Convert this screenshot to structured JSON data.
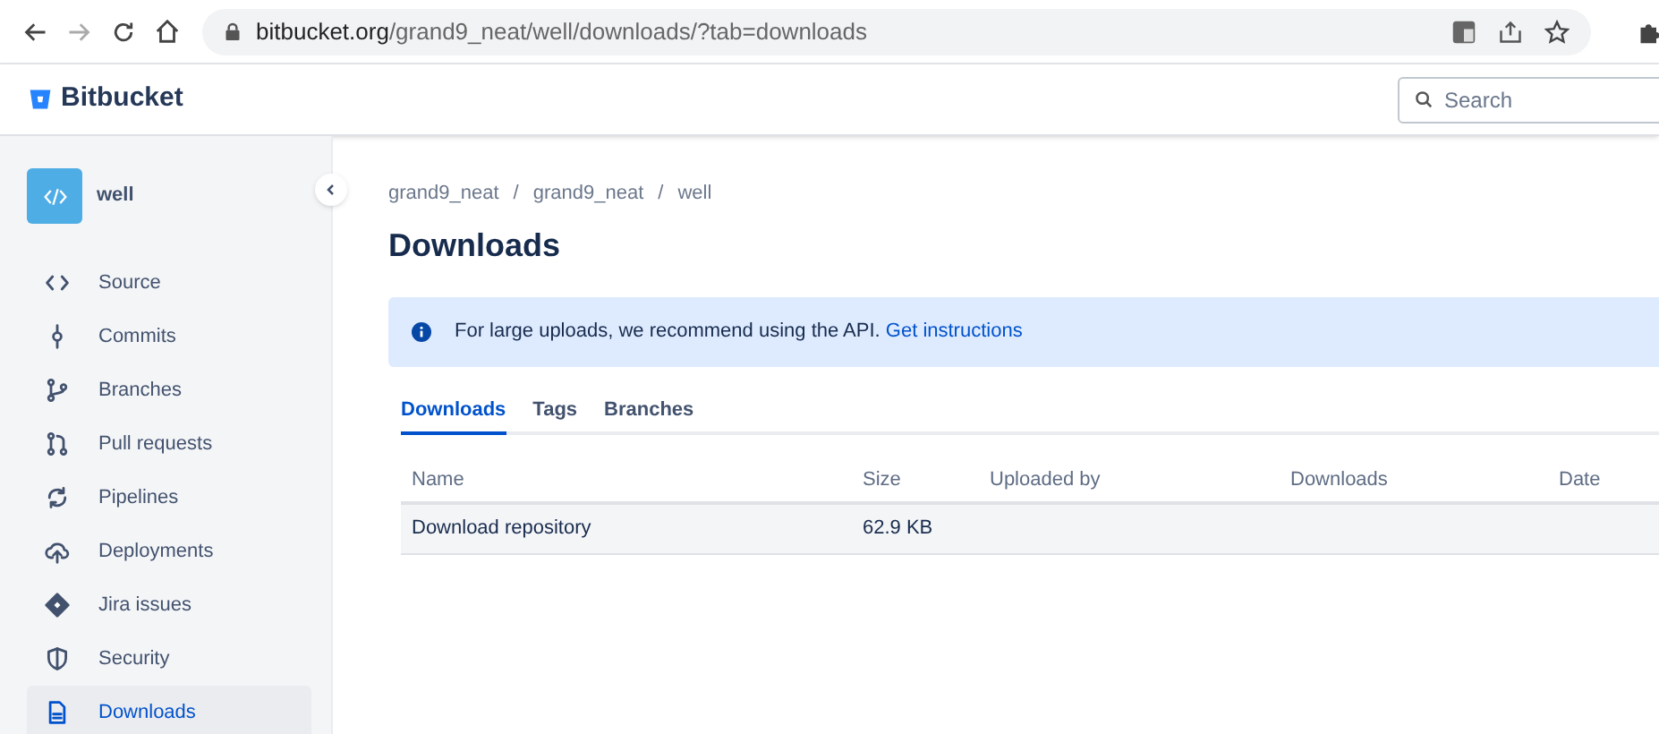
{
  "browser": {
    "url_host": "bitbucket.org",
    "url_path": "/grand9_neat/well/downloads/?tab=downloads"
  },
  "header": {
    "logo": "Bitbucket",
    "search": {
      "placeholder": "Search"
    }
  },
  "sidebar": {
    "repo": "well",
    "items": [
      {
        "label": "Source",
        "selected": false
      },
      {
        "label": "Commits",
        "selected": false
      },
      {
        "label": "Branches",
        "selected": false
      },
      {
        "label": "Pull requests",
        "selected": false
      },
      {
        "label": "Pipelines",
        "selected": false
      },
      {
        "label": "Deployments",
        "selected": false
      },
      {
        "label": "Jira issues",
        "selected": false
      },
      {
        "label": "Security",
        "selected": false
      },
      {
        "label": "Downloads",
        "selected": true
      }
    ]
  },
  "breadcrumbs": [
    {
      "kind": "link",
      "text": "grand9_neat"
    },
    {
      "kind": "separator",
      "text": "/"
    },
    {
      "kind": "link",
      "text": "grand9_neat"
    },
    {
      "kind": "separator",
      "text": "/"
    },
    {
      "kind": "link",
      "text": "well"
    }
  ],
  "title": "Downloads",
  "banner": {
    "text": "For large uploads, we recommend using the API.",
    "link": "Get instructions"
  },
  "tabs": [
    {
      "label": "Downloads",
      "selected": true
    },
    {
      "label": "Tags",
      "selected": false
    },
    {
      "label": "Branches",
      "selected": false
    }
  ],
  "table": {
    "columns": [
      "Name",
      "Size",
      "Uploaded by",
      "Downloads",
      "Date"
    ],
    "rows": [
      [
        "Download repository",
        "62.9 KB",
        "",
        "",
        ""
      ]
    ]
  }
}
